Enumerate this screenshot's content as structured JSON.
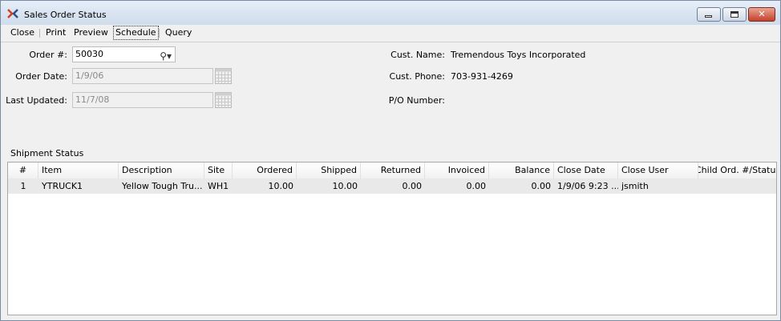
{
  "window": {
    "title": "Sales Order Status",
    "app_icon": "xtuple-x-icon",
    "controls": [
      "minimize-icon",
      "maximize-icon",
      "close-icon"
    ]
  },
  "menu": {
    "close": "Close",
    "print": "Print",
    "preview": "Preview",
    "schedule": "Schedule",
    "query": "Query"
  },
  "form": {
    "order_label": "Order #:",
    "order_value": "50030",
    "order_date_label": "Order Date:",
    "order_date_value": "1/9/06",
    "last_updated_label": "Last Updated:",
    "last_updated_value": "11/7/08",
    "cust_name_label": "Cust. Name:",
    "cust_name_value": "Tremendous Toys Incorporated",
    "cust_phone_label": "Cust. Phone:",
    "cust_phone_value": "703-931-4269",
    "po_label": "P/O Number:",
    "po_value": ""
  },
  "shipment": {
    "section_label": "Shipment Status",
    "columns": [
      "#",
      "Item",
      "Description",
      "Site",
      "Ordered",
      "Shipped",
      "Returned",
      "Invoiced",
      "Balance",
      "Close Date",
      "Close User",
      "Child Ord. #/Status"
    ],
    "rows": [
      [
        "1",
        "YTRUCK1",
        "Yellow Tough Tru...",
        "WH1",
        "10.00",
        "10.00",
        "0.00",
        "0.00",
        "0.00",
        "1/9/06 9:23 ...",
        "jsmith",
        ""
      ]
    ]
  }
}
